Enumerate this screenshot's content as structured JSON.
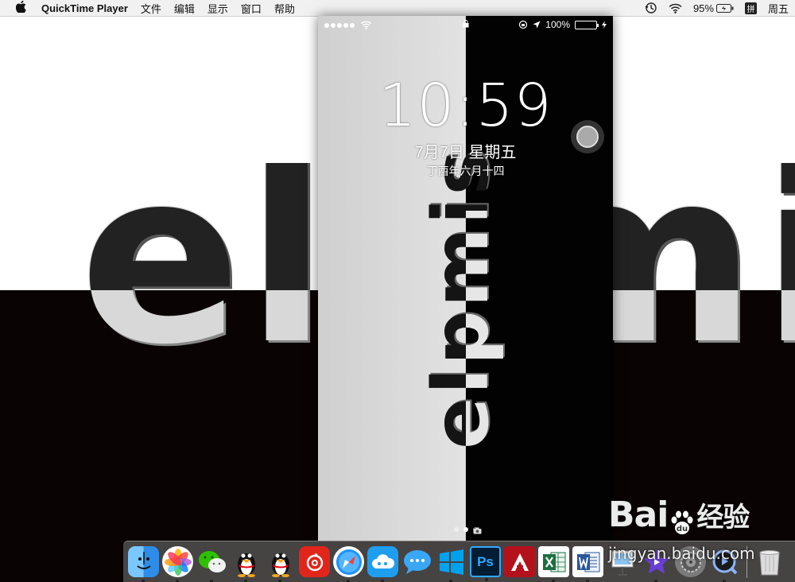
{
  "menubar": {
    "app_name": "QuickTime Player",
    "menus": [
      "文件",
      "编辑",
      "显示",
      "窗口",
      "帮助"
    ],
    "battery_percent": "95%",
    "input_method": "拼",
    "clock": "周五"
  },
  "wallpaper": {
    "word": "elpmis"
  },
  "phone": {
    "time": "10:59",
    "date": "7月7日 星期五",
    "lunar_date": "丁酉年六月十四",
    "battery_percent": "100%",
    "wallpaper_word": "elpmis"
  },
  "dock": {
    "apps": [
      "Finder",
      "Photos",
      "WeChat",
      "QQ",
      "QQ",
      "NetEase Music",
      "Safari",
      "Cloud",
      "Messages",
      "Windows",
      "Photoshop",
      "AutoCAD",
      "Excel",
      "Word",
      "Preview",
      "iMovie",
      "System Preferences",
      "QuickTime",
      "Trash"
    ]
  },
  "watermark": {
    "brand": "Bai",
    "brand_suffix": "经验",
    "url": "jingyan.baidu.com"
  }
}
